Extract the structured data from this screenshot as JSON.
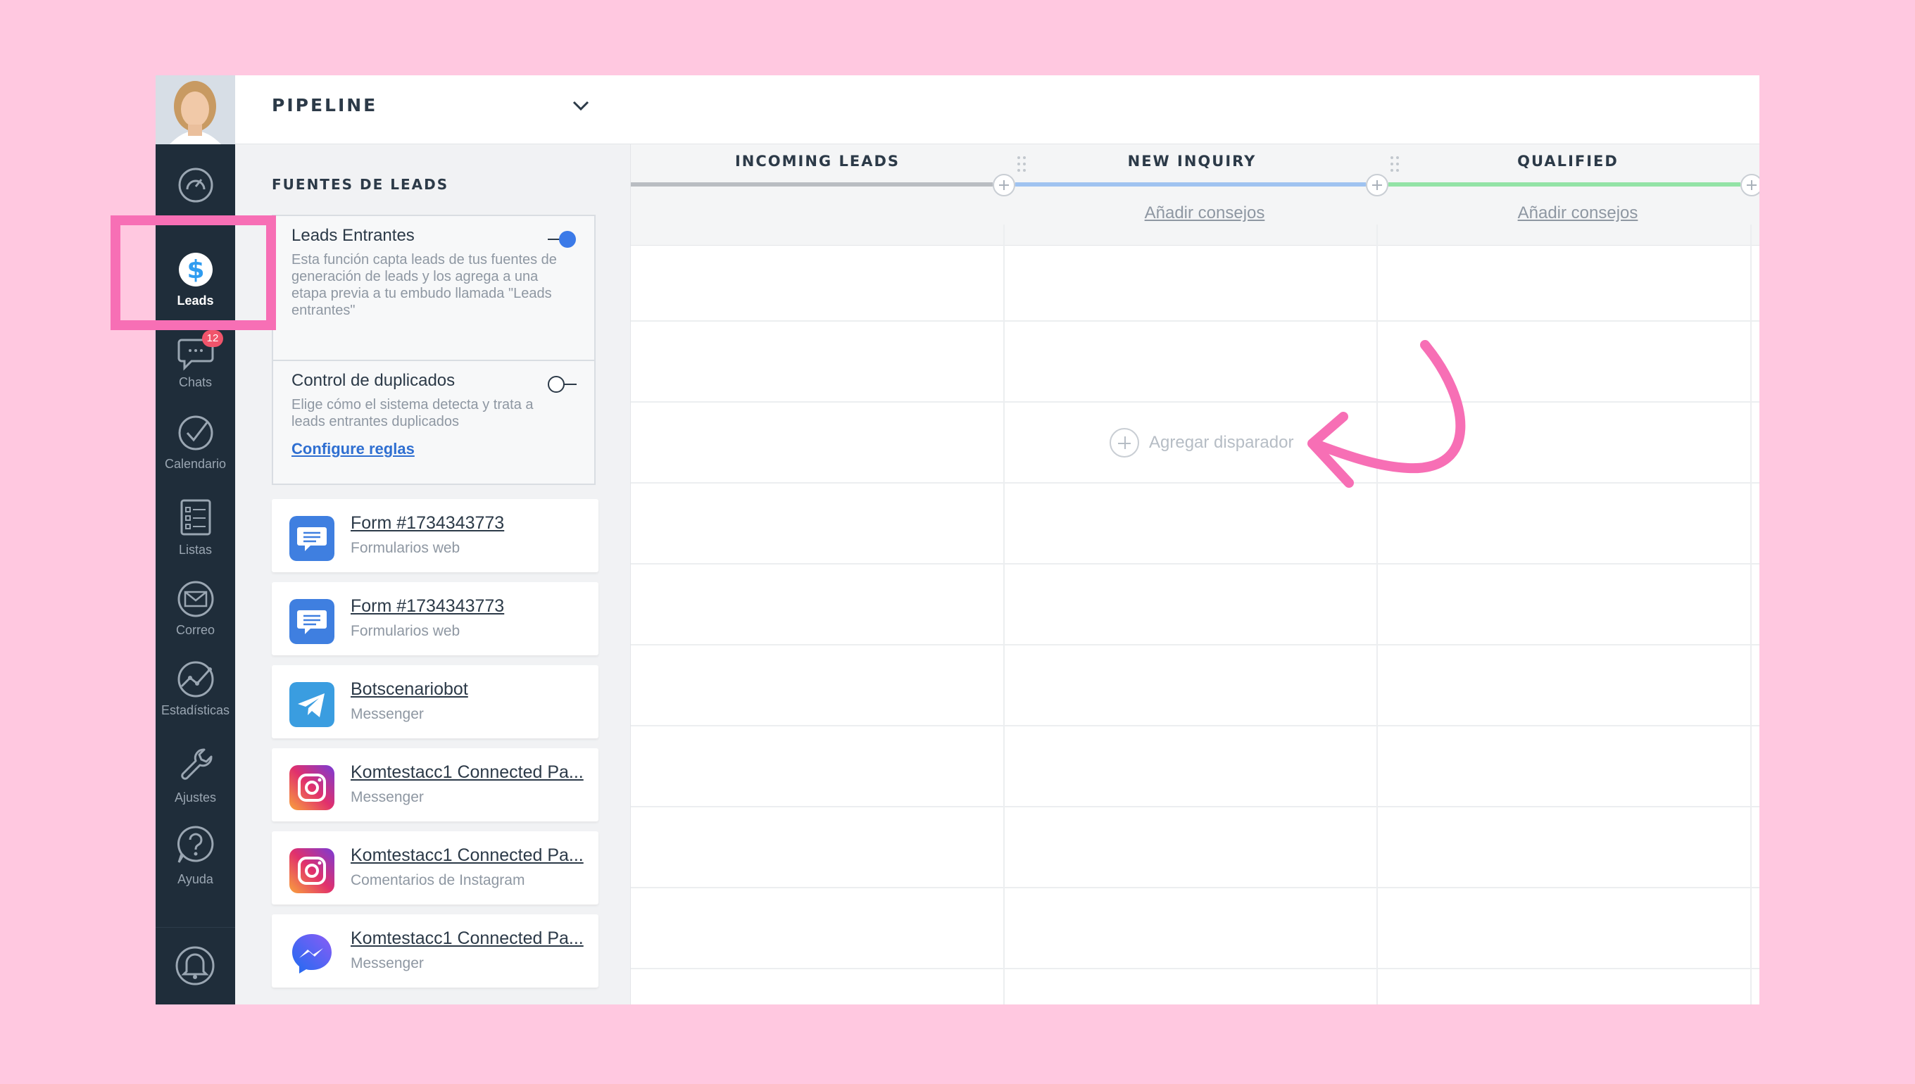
{
  "nav": {
    "items": [
      {
        "label": "",
        "icon": "dashboard-icon"
      },
      {
        "label": "Leads",
        "icon": "leads-dollar-icon",
        "active": true
      },
      {
        "label": "Chats",
        "icon": "chat-bubble-icon",
        "badge": "12"
      },
      {
        "label": "Calendario",
        "icon": "checkmark-circle-icon"
      },
      {
        "label": "Listas",
        "icon": "list-icon"
      },
      {
        "label": "Correo",
        "icon": "mail-icon"
      },
      {
        "label": "Estadísticas",
        "icon": "stats-line-icon"
      },
      {
        "label": "Ajustes",
        "icon": "wrench-icon"
      },
      {
        "label": "Ayuda",
        "icon": "help-question-icon"
      }
    ],
    "bell_icon": "bell-icon"
  },
  "panel": {
    "title": "PIPELINE",
    "section_title": "FUENTES DE LEADS",
    "incoming": {
      "title": "Leads Entrantes",
      "desc": "Esta función capta leads de tus fuentes de generación de leads y los agrega a una etapa previa a tu embudo llamada \"Leads entrantes\"",
      "enabled": true
    },
    "duplicates": {
      "title": "Control de duplicados",
      "desc": "Elige cómo el sistema detecta y trata a leads entrantes duplicados",
      "link": "Configure reglas",
      "enabled": false
    },
    "sources": [
      {
        "name": "Form #1734343773",
        "type": "Formularios web",
        "icon": "web-form-icon"
      },
      {
        "name": "Form #1734343773",
        "type": "Formularios web",
        "icon": "web-form-icon"
      },
      {
        "name": "Botscenariobot",
        "type": "Messenger",
        "icon": "telegram-icon"
      },
      {
        "name": "Komtestacc1 Connected Pa...",
        "type": "Messenger",
        "icon": "instagram-icon"
      },
      {
        "name": "Komtestacc1 Connected Pa...",
        "type": "Comentarios de Instagram",
        "icon": "instagram-icon"
      },
      {
        "name": "Komtestacc1 Connected Pa...",
        "type": "Messenger",
        "icon": "facebook-messenger-icon"
      }
    ]
  },
  "board": {
    "columns": [
      {
        "title": "INCOMING LEADS",
        "color": "#b9bdc2",
        "tip": ""
      },
      {
        "title": "NEW INQUIRY",
        "color": "#9fc3f0",
        "tip": "Añadir consejos"
      },
      {
        "title": "QUALIFIED",
        "color": "#93e3a6",
        "tip": "Añadir consejos"
      }
    ],
    "add_trigger": "Agregar disparador"
  },
  "annotations": {
    "highlight_color": "#f76fb5",
    "arrow_color": "#f76fb5"
  }
}
